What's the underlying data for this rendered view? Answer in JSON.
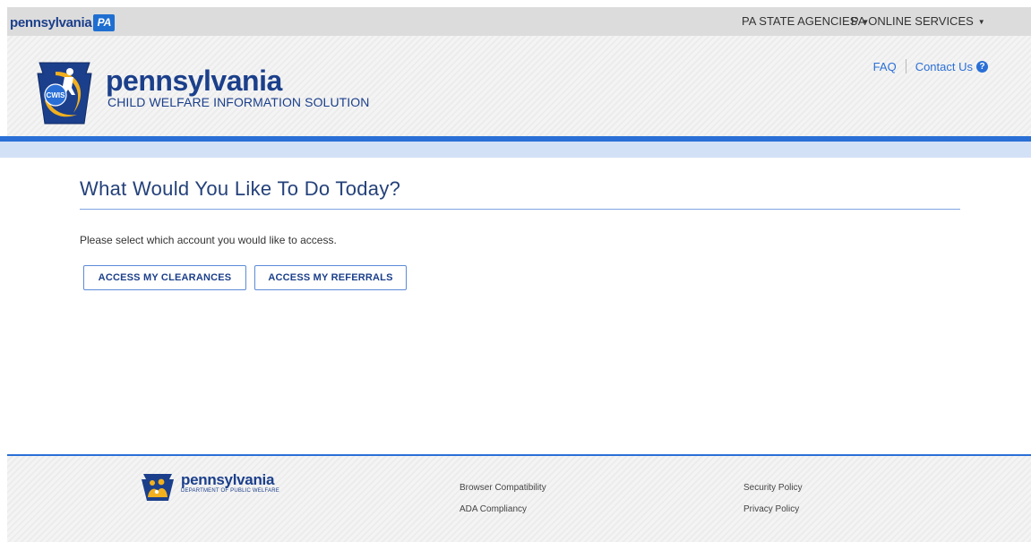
{
  "topbar": {
    "brand_word": "pennsylvania",
    "brand_badge": "PA",
    "nav_agencies": "PA STATE AGENCIES",
    "nav_services": "PA ONLINE SERVICES"
  },
  "header": {
    "badge_text": "CWIS",
    "title": "pennsylvania",
    "subtitle": "CHILD WELFARE INFORMATION SOLUTION",
    "faq": "FAQ",
    "contact": "Contact Us",
    "help_glyph": "?"
  },
  "main": {
    "heading": "What Would You Like To Do Today?",
    "prompt": "Please select which account you would like to access.",
    "button_clearances": "ACCESS MY CLEARANCES",
    "button_referrals": "ACCESS MY REFERRALS"
  },
  "footer": {
    "logo_title": "pennsylvania",
    "logo_sub": "DEPARTMENT OF PUBLIC WELFARE",
    "browser_compat": "Browser Compatibility",
    "ada": "ADA Compliancy",
    "security": "Security Policy",
    "privacy": "Privacy Policy"
  },
  "colors": {
    "brand_blue": "#1b3f8b",
    "accent_blue": "#2a6fd6",
    "gold": "#f2b01e"
  },
  "icons": {
    "caret": "caret-down-icon",
    "help": "question-circle-icon",
    "logo": "keystone-badge-icon"
  }
}
